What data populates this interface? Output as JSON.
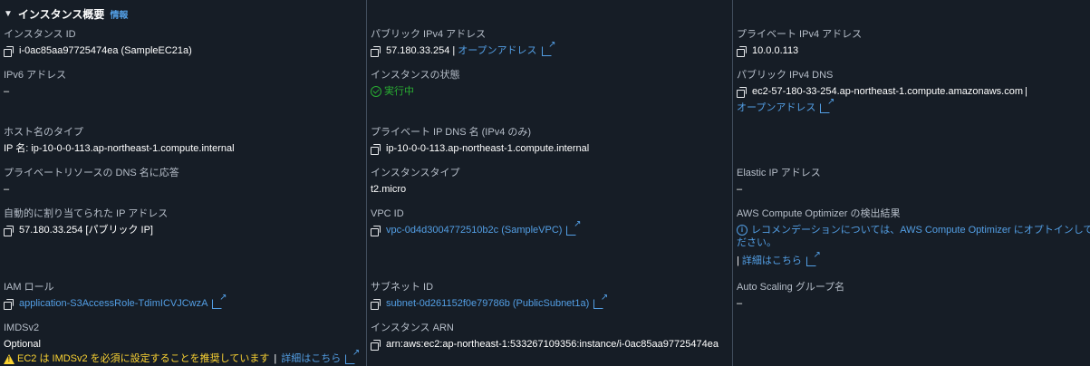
{
  "header": {
    "toggle": "▼",
    "title": "インスタンス概要",
    "info": "情報"
  },
  "col1": {
    "instance_id": {
      "label": "インスタンス ID",
      "value": "i-0ac85aa97725474ea (SampleEC21a)"
    },
    "ipv6": {
      "label": "IPv6 アドレス",
      "value": "–"
    },
    "hostname_type": {
      "label": "ホスト名のタイプ",
      "value": "IP 名: ip-10-0-0-113.ap-northeast-1.compute.internal"
    },
    "private_dns_answer": {
      "label": "プライベートリソースの DNS 名に応答",
      "value": "–"
    },
    "auto_ip": {
      "label": "自動的に割り当てられた IP アドレス",
      "value": "57.180.33.254 [パブリック IP]"
    },
    "iam_role": {
      "label": "IAM ロール",
      "value": "application-S3AccessRole-TdimICVJCwzA"
    },
    "imdsv2": {
      "label": "IMDSv2",
      "value": "Optional",
      "warning": "EC2 は IMDSv2 を必須に設定することを推奨しています",
      "sep": "|",
      "details": "詳細はこちら"
    }
  },
  "col2": {
    "public_ipv4": {
      "label": "パブリック IPv4 アドレス",
      "value": "57.180.33.254",
      "sep": "|",
      "link": "オープンアドレス"
    },
    "state": {
      "label": "インスタンスの状態",
      "value": "実行中"
    },
    "private_ip_dns": {
      "label": "プライベート IP DNS 名 (IPv4 のみ)",
      "value": "ip-10-0-0-113.ap-northeast-1.compute.internal"
    },
    "instance_type": {
      "label": "インスタンスタイプ",
      "value": "t2.micro"
    },
    "vpc_id": {
      "label": "VPC ID",
      "value": "vpc-0d4d3004772510b2c (SampleVPC)"
    },
    "subnet_id": {
      "label": "サブネット ID",
      "value": "subnet-0d261152f0e79786b (PublicSubnet1a)"
    },
    "arn": {
      "label": "インスタンス ARN",
      "value": "arn:aws:ec2:ap-northeast-1:533267109356:instance/i-0ac85aa97725474ea"
    }
  },
  "col3": {
    "private_ipv4": {
      "label": "プライベート IPv4 アドレス",
      "value": "10.0.0.113"
    },
    "public_dns": {
      "label": "パブリック IPv4 DNS",
      "value": "ec2-57-180-33-254.ap-northeast-1.compute.amazonaws.com",
      "sep": "|",
      "link": "オープンアドレス"
    },
    "elastic_ip": {
      "label": "Elastic IP アドレス",
      "value": "–"
    },
    "optimizer": {
      "label": "AWS Compute Optimizer の検出結果",
      "line1": "レコメンデーションについては、AWS Compute Optimizer にオプトインしてく",
      "line2": "ださい。",
      "sep": "|",
      "details": "詳細はこちら"
    },
    "asg": {
      "label": "Auto Scaling グループ名",
      "value": "–"
    }
  },
  "colors": {
    "background": "#161d26",
    "link": "#539fe5",
    "success": "#29ad32",
    "warning": "#fbd332"
  }
}
